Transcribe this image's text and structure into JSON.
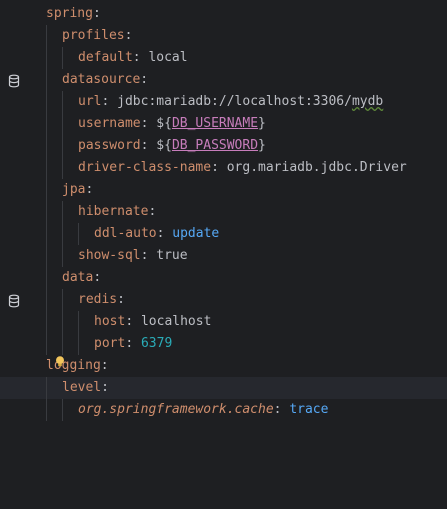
{
  "editor": {
    "lines": [
      {
        "k": "spring",
        "s": ":"
      },
      {
        "k": "profiles",
        "s": ":"
      },
      {
        "k": "default",
        "s": ": ",
        "v": "local"
      },
      {
        "k": "datasource",
        "s": ":"
      },
      {
        "k": "url",
        "s": ": ",
        "v": "jdbc:mariadb://localhost:3306/",
        "v2": "mydb"
      },
      {
        "k": "username",
        "s": ": ",
        "p1": "${",
        "ph": "DB_USERNAME",
        "p2": "}"
      },
      {
        "k": "password",
        "s": ": ",
        "p1": "${",
        "ph": "DB_PASSWORD",
        "p2": "}"
      },
      {
        "k": "driver-class-name",
        "s": ": ",
        "v": "org.mariadb.jdbc.Driver"
      },
      {
        "k": "jpa",
        "s": ":"
      },
      {
        "k": "hibernate",
        "s": ":"
      },
      {
        "k": "ddl-auto",
        "s": ": ",
        "kw": "update"
      },
      {
        "k": "show-sql",
        "s": ": ",
        "v": "true"
      },
      {
        "k": "data",
        "s": ":"
      },
      {
        "k": "redis",
        "s": ":"
      },
      {
        "k": "host",
        "s": ": ",
        "v": "localhost"
      },
      {
        "k": "port",
        "s": ": ",
        "num": "6379"
      },
      {
        "k": "logging",
        "s": ":"
      },
      {
        "k": "level",
        "s": ":"
      },
      {
        "k": "org.springframework.cache",
        "s": ": ",
        "kw": "trace"
      }
    ]
  },
  "gutter": {
    "icons": [
      "database-icon",
      "database-icon",
      "lightbulb-icon"
    ]
  },
  "colors": {
    "background": "#1e1f22",
    "key": "#cf8e6d",
    "text": "#bcbec4",
    "keyword": "#56a8f5",
    "number": "#2aacb8",
    "placeholder": "#c77dbb"
  }
}
